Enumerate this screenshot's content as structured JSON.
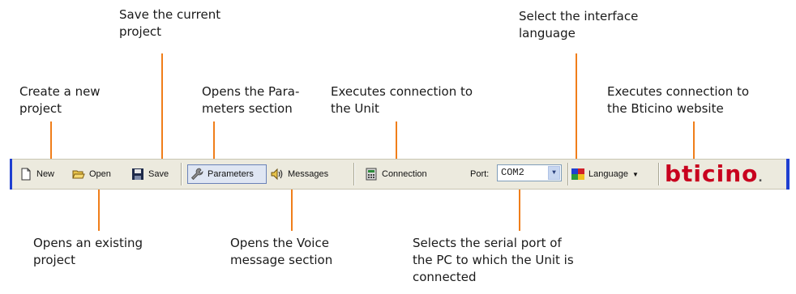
{
  "toolbar": {
    "new_label": "New",
    "open_label": "Open",
    "save_label": "Save",
    "parameters_label": "Parameters",
    "messages_label": "Messages",
    "connection_label": "Connection",
    "port_label": "Port:",
    "port_value": "COM2",
    "language_label": "Language",
    "logo_text": "bticino",
    "logo_suffix": "."
  },
  "callouts": {
    "new": [
      "Create a new",
      "project"
    ],
    "open": [
      "Opens an existing",
      "project"
    ],
    "save": [
      "Save the current",
      "project"
    ],
    "parameters": [
      "Opens the Para-",
      "meters section"
    ],
    "messages": [
      "Opens the Voice",
      "message section"
    ],
    "connection": [
      "Executes connection to",
      "the Unit"
    ],
    "port": [
      "Selects the serial port of",
      "the PC to which the Unit is",
      "connected"
    ],
    "language": [
      "Select the interface",
      "language"
    ],
    "website": [
      "Executes connection to",
      "the Bticino website"
    ]
  },
  "colors": {
    "leader": "#f07e1a",
    "toolbar_bg": "#eceade",
    "toolbar_edge": "#1f3fd0",
    "logo": "#c8001e"
  },
  "icons": [
    "new-document-icon",
    "open-folder-icon",
    "save-disk-icon",
    "parameters-wrench-icon",
    "speaker-icon",
    "connection-icon",
    "chevron-down-icon",
    "language-flag-icon"
  ]
}
